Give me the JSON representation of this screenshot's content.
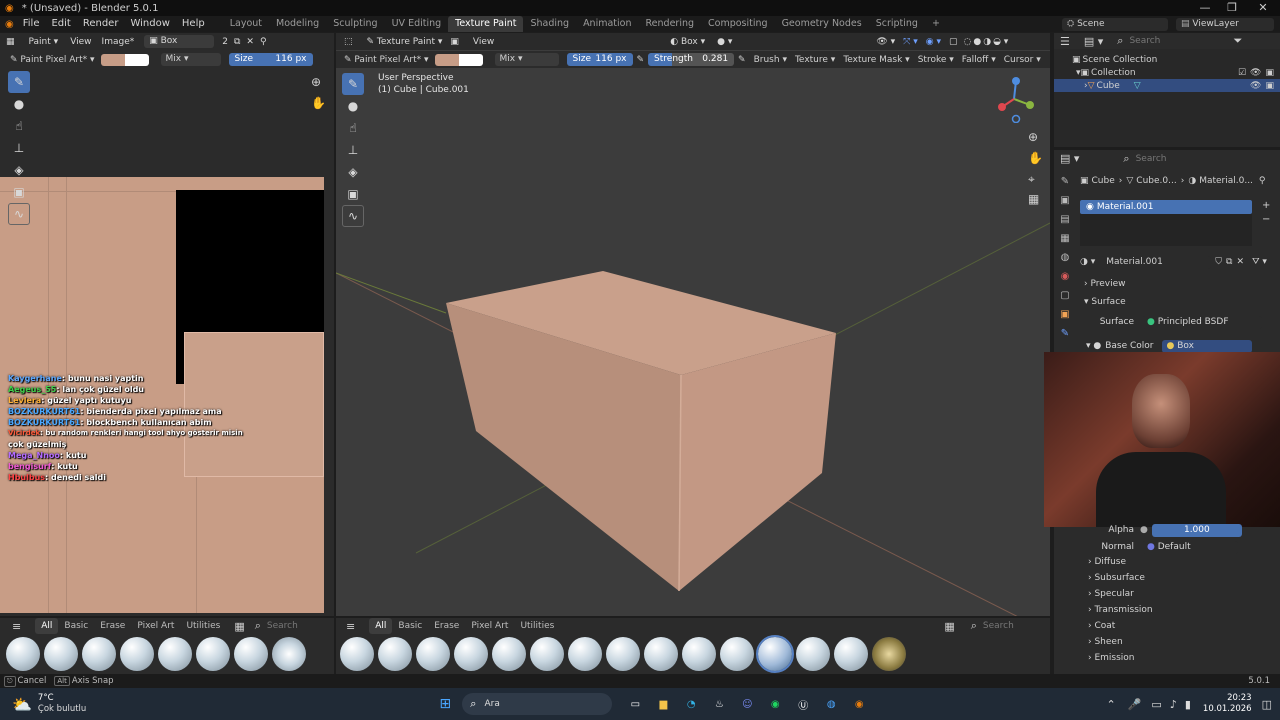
{
  "window": {
    "title": "* (Unsaved) - Blender 5.0.1",
    "controls": [
      "—",
      "❐",
      "✕"
    ]
  },
  "menu": [
    "File",
    "Edit",
    "Render",
    "Window",
    "Help"
  ],
  "workspaces": [
    "Layout",
    "Modeling",
    "Sculpting",
    "UV Editing",
    "Texture Paint",
    "Shading",
    "Animation",
    "Rendering",
    "Compositing",
    "Geometry Nodes",
    "Scripting",
    "+"
  ],
  "top_right": {
    "scene": "Scene",
    "view_layer": "ViewLayer"
  },
  "image_editor": {
    "mode": "Paint",
    "view": "View",
    "image": "Image*",
    "image_name": "Box",
    "users": "2",
    "brush": "Paint Pixel Art*",
    "blend": "Mix",
    "size_label": "Size",
    "size_value": "116 px"
  },
  "viewport": {
    "mode": "Texture Paint",
    "view": "View",
    "projection": "Box",
    "brush": "Paint Pixel Art*",
    "blend": "Mix",
    "size_label": "Size",
    "size_value": "116 px",
    "strength_label": "Strength",
    "strength_value": "0.281",
    "menus": [
      "Brush",
      "Texture",
      "Texture Mask",
      "Stroke",
      "Falloff",
      "Cursor"
    ],
    "perspective": "User Perspective",
    "object_info": "(1) Cube | Cube.001"
  },
  "chat": [
    {
      "user": "Kaygerhane",
      "msg": "bunu nasi yaptin",
      "color": "#5da8ff"
    },
    {
      "user": "Aegeus_55",
      "msg": "lan çok güzel oldu",
      "color": "#3fd04b"
    },
    {
      "user": "Levlera",
      "msg": "güzel yaptı kutuyu",
      "color": "#ffb238"
    },
    {
      "user": "BOZKURKURT61",
      "msg": "bienderda pixel yapılmaz ama",
      "color": "#4aa8ff"
    },
    {
      "user": "BOZKURKURT61",
      "msg": "blockbench kullanıcan abim",
      "color": "#4aa8ff"
    },
    {
      "user": "Vicirdek",
      "msg": "bu random renkleri hangi tool ahyo gösterir misin",
      "color": "#ff5a3a"
    },
    {
      "user": "",
      "msg": "çok güzelmiş",
      "color": "#ffffff"
    },
    {
      "user": "Mega_Nnoo",
      "msg": "kutu",
      "color": "#b46bff"
    },
    {
      "user": "bengisurf",
      "msg": "kutu",
      "color": "#f05ad5"
    },
    {
      "user": "Hbulbus",
      "msg": "denedi saldi",
      "color": "#ff4545"
    }
  ],
  "brush_bar": {
    "categories": [
      "All",
      "Basic",
      "Erase",
      "Pixel Art",
      "Utilities"
    ],
    "search_placeholder": "Search"
  },
  "status": {
    "cancel": "Cancel",
    "axis_snap": "Axis Snap",
    "version": "5.0.1"
  },
  "outliner": {
    "search_placeholder": "Search",
    "scene_collection": "Scene Collection",
    "collection": "Collection",
    "object": "Cube"
  },
  "properties": {
    "search_placeholder": "Search",
    "breadcrumb": [
      "Cube",
      "Cube.0...",
      "Material.0..."
    ],
    "slot": "Material.001",
    "material_name": "Material.001",
    "sections": {
      "preview": "Preview",
      "surface": "Surface"
    },
    "surface_label": "Surface",
    "surface_value": "Principled BSDF",
    "base_color_label": "Base Color",
    "base_color_value": "Box",
    "alpha_label": "Alpha",
    "alpha_value": "1.000",
    "normal_label": "Normal",
    "normal_value": "Default",
    "panels": [
      "Diffuse",
      "Subsurface",
      "Specular",
      "Transmission",
      "Coat",
      "Sheen",
      "Emission"
    ]
  },
  "taskbar": {
    "temperature": "7°C",
    "weather": "Çok bulutlu",
    "search": "Ara",
    "time": "20:23",
    "date": "10.01.2026"
  },
  "colors": {
    "paint_primary": "#c79d87",
    "paint_secondary": "#ffffff",
    "accent": "#4772b3",
    "cube": "#c29a85"
  }
}
